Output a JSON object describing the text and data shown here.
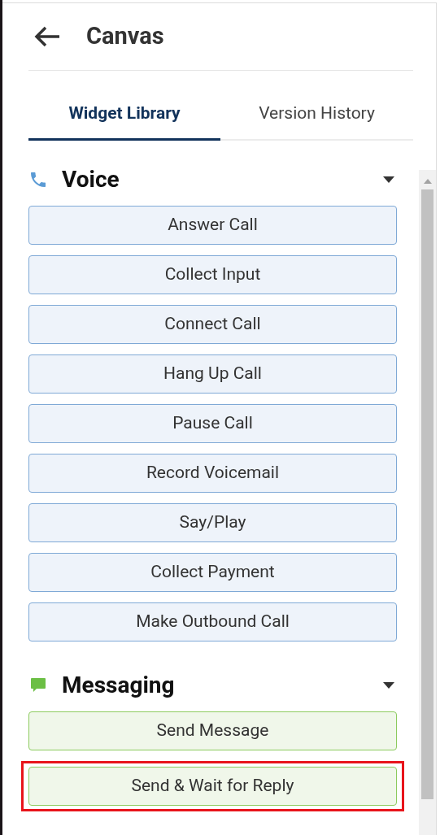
{
  "header": {
    "title": "Canvas"
  },
  "tabs": [
    {
      "label": "Widget Library",
      "selected": true
    },
    {
      "label": "Version History",
      "selected": false
    }
  ],
  "sections": [
    {
      "title": "Voice",
      "kind": "voice",
      "expanded": true,
      "widgets": [
        {
          "label": "Answer Call",
          "highlighted": false
        },
        {
          "label": "Collect Input",
          "highlighted": false
        },
        {
          "label": "Connect Call",
          "highlighted": false
        },
        {
          "label": "Hang Up Call",
          "highlighted": false
        },
        {
          "label": "Pause Call",
          "highlighted": false
        },
        {
          "label": "Record Voicemail",
          "highlighted": false
        },
        {
          "label": "Say/Play",
          "highlighted": false
        },
        {
          "label": "Collect Payment",
          "highlighted": false
        },
        {
          "label": "Make Outbound Call",
          "highlighted": false
        }
      ]
    },
    {
      "title": "Messaging",
      "kind": "messaging",
      "expanded": true,
      "widgets": [
        {
          "label": "Send Message",
          "highlighted": false
        },
        {
          "label": "Send & Wait for Reply",
          "highlighted": true
        }
      ]
    }
  ]
}
